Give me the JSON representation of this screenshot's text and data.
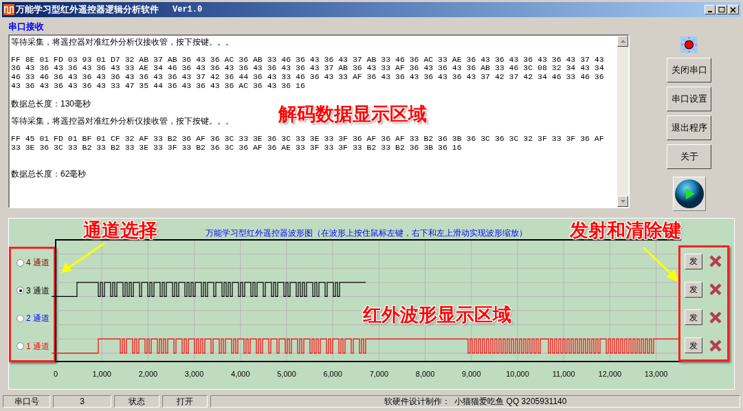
{
  "window": {
    "title": "万能学习型红外遥控器逻辑分析软件",
    "version": "Ver1.0"
  },
  "receive_label": "串口接收",
  "log": [
    {
      "kind": "message",
      "text": "等待采集，将遥控器对准红外分析仪接收管，按下按键。。。"
    },
    {
      "kind": "hex",
      "lines": [
        "FF 8E 01 FD 03 93 01 D7 32 AB 37 AB 36 43 36 AC 36 AB 33 46 36 43 36 43 37 AB 33 46 36 AC 33 AE 36 43 36 43 36 43 36 43 37 43",
        "36 43 36 43 36 43 36 43 33 AE 34 46 36 43 36 43 36 43 36 43 36 43 37 AB 36 43 33 AF 36 43 36 43 36 AB 33 46 3C 08 32 34 43 34",
        "46 33 46 36 43 36 43 36 43 36 43 36 43 37 42 36 44 36 43 33 46 36 43 33 AF 36 43 36 43 36 43 36 43 37 42 37 42 34 46 33 46 36",
        "43 36 43 36 43 36 43 33 47 35 44 36 43 36 43 36 AC 36 43 36 16"
      ]
    },
    {
      "kind": "message",
      "text": "数据总长度：130毫秒"
    },
    {
      "kind": "message",
      "text": "等待采集，将遥控器对准红外分析仪接收管，按下按键。。。"
    },
    {
      "kind": "hex",
      "lines": [
        "FF 45 01 FD 01 BF 01 CF 32 AF 33 B2 36 AF 36 3C 33 3E 36 3C 33 3E 33 3F 36 AF 36 AF 33 B2 36 3B 36 3C 36 3C 32 3F 33 3F 36 AF",
        "33 3E 36 3C 33 B2 33 B2 33 3E 33 3F 33 B2 36 3C 36 AF 36 AE 33 3F 33 3F 33 B2 33 B2 36 3B 36 16"
      ]
    },
    {
      "kind": "blank"
    },
    {
      "kind": "message",
      "text": "数据总长度：62毫秒"
    }
  ],
  "side_buttons": [
    "关闭串口",
    "串口设置",
    "退出程序",
    "关于"
  ],
  "waveform": {
    "title": "万能学习型红外遥控器波形图（在波形上按住鼠标左键，右下和左上滑动实现波形缩放）",
    "x_tick_labels": [
      "0",
      "1,000",
      "2,000",
      "3,000",
      "4,000",
      "5,000",
      "6,000",
      "7,000",
      "8,000",
      "9,000",
      "10,000",
      "11,000",
      "12,000",
      "13,000"
    ],
    "channels": [
      {
        "number": "4",
        "label": "通道",
        "color": "#800000",
        "selected": false,
        "send": "发"
      },
      {
        "number": "3",
        "label": "通道",
        "color": "#000000",
        "selected": true,
        "send": "发"
      },
      {
        "number": "2",
        "label": "通道",
        "color": "#0000ff",
        "selected": false,
        "send": "发"
      },
      {
        "number": "1",
        "label": "通道",
        "color": "#ff0000",
        "selected": false,
        "send": "发"
      }
    ]
  },
  "annotations": [
    "解码数据显示区域",
    "通道选择",
    "红外波形显示区域",
    "发射和清除键"
  ],
  "status_bar": [
    "串口号",
    "3",
    "状态",
    "打开",
    "软硬件设计制作：  小猫猫爱吃鱼 QQ 3205931140"
  ]
}
